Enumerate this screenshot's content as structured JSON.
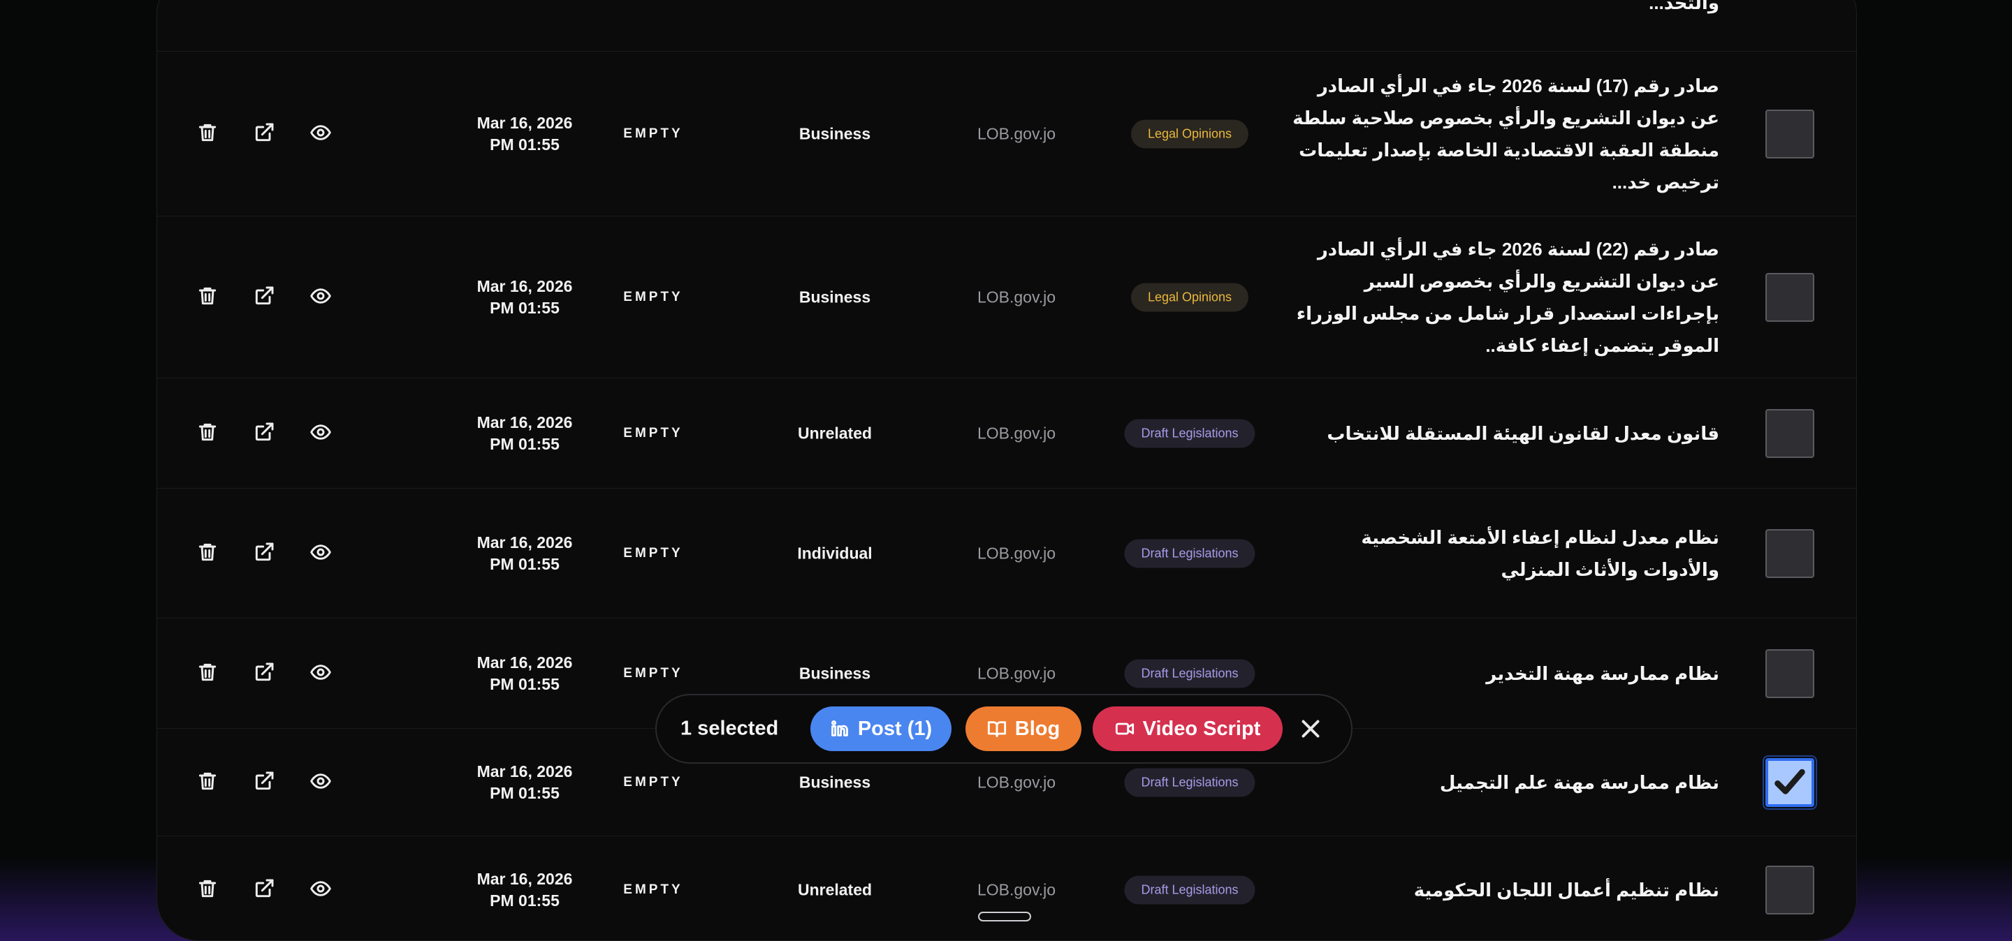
{
  "rows": [
    {
      "title": "صادر رقم (17) لسنة 2026 جاء في الرأي الصادر عن ديوان التشريع والرأي بخصوص صلاحية سلطة منطقة العقبة الاقتصادية الخاصة بإصدار تعليمات ترخيص خد...",
      "badge": "Legal Opinions",
      "source": "LOB.gov.jo",
      "category": "Business",
      "status": "EMPTY",
      "date": "Mar 16, 2026",
      "time": "PM 01:55",
      "selected": false
    },
    {
      "title": "صادر رقم (22) لسنة 2026 جاء في الرأي الصادر عن ديوان التشريع والرأي بخصوص السير بإجراءات استصدار قرار شامل من مجلس الوزراء الموقر يتضمن إعفاء كافة..",
      "badge": "Legal Opinions",
      "source": "LOB.gov.jo",
      "category": "Business",
      "status": "EMPTY",
      "date": "Mar 16, 2026",
      "time": "PM 01:55",
      "selected": false
    },
    {
      "title": "قانون معدل لقانون الهيئة المستقلة للانتخاب",
      "badge": "Draft Legislations",
      "source": "LOB.gov.jo",
      "category": "Unrelated",
      "status": "EMPTY",
      "date": "Mar 16, 2026",
      "time": "PM 01:55",
      "selected": false
    },
    {
      "title": "نظام معدل لنظام إعفاء الأمتعة الشخصية والأدوات والأثاث المنزلي",
      "badge": "Draft Legislations",
      "source": "LOB.gov.jo",
      "category": "Individual",
      "status": "EMPTY",
      "date": "Mar 16, 2026",
      "time": "PM 01:55",
      "selected": false
    },
    {
      "title": "نظام ممارسة مهنة التخدير",
      "badge": "Draft Legislations",
      "source": "LOB.gov.jo",
      "category": "Business",
      "status": "EMPTY",
      "date": "Mar 16, 2026",
      "time": "PM 01:55",
      "selected": false
    },
    {
      "title": "نظام ممارسة مهنة علم التجميل",
      "badge": "Draft Legislations",
      "source": "LOB.gov.jo",
      "category": "Business",
      "status": "EMPTY",
      "date": "Mar 16, 2026",
      "time": "PM 01:55",
      "selected": true
    },
    {
      "title": "نظام تنظيم أعمال اللجان الحكومية",
      "badge": "Draft Legislations",
      "source": "LOB.gov.jo",
      "category": "Unrelated",
      "status": "EMPTY",
      "date": "Mar 16, 2026",
      "time": "PM 01:55",
      "selected": false
    }
  ],
  "top_partial_text": "للموظفين المحددة رواتبهم وفق تعليمات التقييم والتحد...",
  "action_bar": {
    "selected_label": "1 selected",
    "post_label": "Post (1)",
    "blog_label": "Blog",
    "video_label": "Video Script"
  },
  "colors": {
    "post": "#4a86f0",
    "blog": "#ed7c30",
    "video": "#d6304f",
    "legal_badge": "#e9b93c",
    "draft_badge": "#a89ae8"
  },
  "icons": {
    "delete": "trash-icon",
    "open": "external-link-icon",
    "view": "eye-icon",
    "check": "checkmark-icon",
    "linkedin": "linkedin-icon",
    "blog": "book-icon",
    "video": "video-icon",
    "close": "close-icon"
  }
}
